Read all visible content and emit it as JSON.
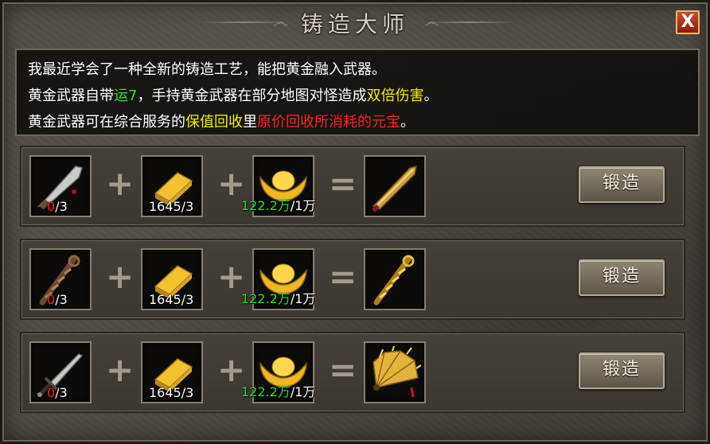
{
  "window": {
    "title": "铸造大师",
    "close_label": "X"
  },
  "info": {
    "line1": "我最近学会了一种全新的铸造工艺，能把黄金融入武器。",
    "line2_a": "黄金武器自带",
    "line2_b": "运7",
    "line2_c": "，手持黄金武器在部分地图对怪造成",
    "line2_d": "双倍伤害",
    "line2_e": "。",
    "line3_a": "黄金武器可在综合服务的",
    "line3_b": "保值回收",
    "line3_c": "里",
    "line3_d": "原价回收所消耗的元宝",
    "line3_e": "。"
  },
  "rows": [
    {
      "weapon_icon": "blade-icon",
      "weapon_have": "0",
      "weapon_need": "/3",
      "gold_have": "1645",
      "gold_need": "/3",
      "ingot_have": "122.2万",
      "ingot_need": "/1万",
      "plus": "+",
      "equals": "=",
      "result_icon": "golden-blade-icon",
      "button_label": "锻造"
    },
    {
      "weapon_icon": "staff-icon",
      "weapon_have": "0",
      "weapon_need": "/3",
      "gold_have": "1645",
      "gold_need": "/3",
      "ingot_have": "122.2万",
      "ingot_need": "/1万",
      "plus": "+",
      "equals": "=",
      "result_icon": "golden-staff-icon",
      "button_label": "锻造"
    },
    {
      "weapon_icon": "sword-icon",
      "weapon_have": "0",
      "weapon_need": "/3",
      "gold_have": "1645",
      "gold_need": "/3",
      "ingot_have": "122.2万",
      "ingot_need": "/1万",
      "plus": "+",
      "equals": "=",
      "result_icon": "golden-fan-icon",
      "button_label": "锻造"
    }
  ],
  "colors": {
    "have_insufficient": "#ff2020",
    "have_sufficient": "#2fe02f",
    "highlight_yellow": "#f3f000"
  }
}
